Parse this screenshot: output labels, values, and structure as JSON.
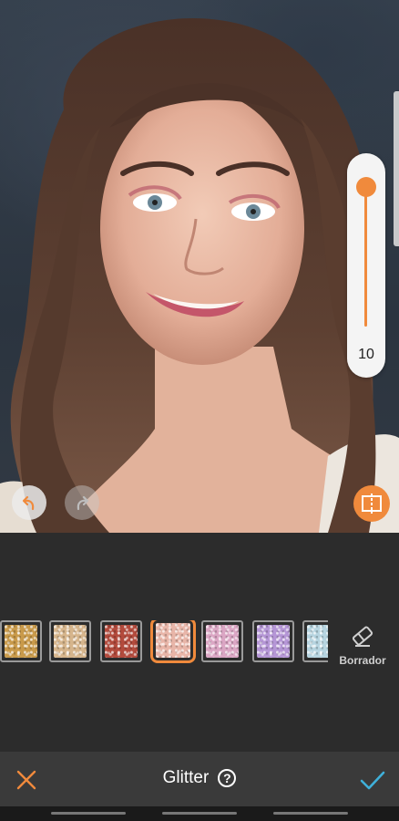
{
  "editor": {
    "intensity_value": "10",
    "intensity_level": 0.1,
    "icons": {
      "undo": "undo-arrow-icon",
      "redo": "redo-arrow-icon",
      "compare": "compare-split-icon",
      "eraser": "eraser-icon",
      "close": "close-x-icon",
      "confirm": "checkmark-icon",
      "help": "question-mark-icon"
    }
  },
  "swatches": [
    {
      "name": "gold",
      "color": "#c99a4a",
      "selected": false
    },
    {
      "name": "champagne",
      "color": "#d6b58c",
      "selected": false
    },
    {
      "name": "red",
      "color": "#b34a3c",
      "selected": false
    },
    {
      "name": "peach-pink",
      "color": "#e8b5a8",
      "selected": true
    },
    {
      "name": "pink",
      "color": "#dba6c4",
      "selected": false
    },
    {
      "name": "lilac",
      "color": "#b596d6",
      "selected": false
    },
    {
      "name": "ice-blue",
      "color": "#b6d4e0",
      "selected": false
    }
  ],
  "eraser": {
    "label": "Borrador"
  },
  "bottom_bar": {
    "title": "Glitter",
    "help_symbol": "?"
  },
  "colors": {
    "accent": "#f08a3c",
    "confirm": "#3fb0d9",
    "panel": "#2c2c2c",
    "bar": "#3a3a3a"
  }
}
